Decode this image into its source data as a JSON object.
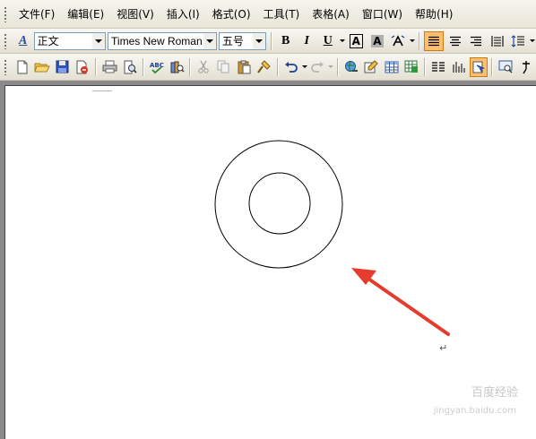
{
  "menu": {
    "items": [
      "文件(F)",
      "编辑(E)",
      "视图(V)",
      "插入(I)",
      "格式(O)",
      "工具(T)",
      "表格(A)",
      "窗口(W)",
      "帮助(H)"
    ]
  },
  "format_toolbar": {
    "style_value": "正文",
    "font_value": "Times New Roman",
    "size_value": "五号",
    "bold_label": "B",
    "italic_label": "I",
    "underline_label": "U",
    "char_border_label": "A",
    "char_shading_label": "A",
    "style_icon_label": "A"
  },
  "document": {
    "paragraph_mark": "↵",
    "watermark": "百度经验",
    "watermark_url": "jingyan.baidu.com"
  },
  "colors": {
    "arrow": "#e53c2e",
    "active_button": "#ffc06e"
  }
}
